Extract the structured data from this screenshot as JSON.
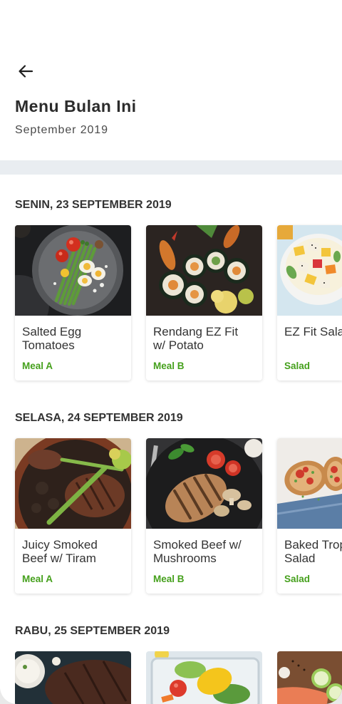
{
  "colors": {
    "accent": "#45a01c",
    "divider": "#e9edf1",
    "text": "#333333"
  },
  "icons": {
    "back": "arrow-left-icon"
  },
  "header": {
    "title": "Menu Bulan Ini",
    "subtitle": "September 2019"
  },
  "days": [
    {
      "label": "SENIN, 23 SEPTEMBER 2019",
      "meals": [
        {
          "name": "Salted Egg\nTomatoes",
          "tag": "Meal A"
        },
        {
          "name": "Rendang EZ Fit\nw/ Potato",
          "tag": "Meal B"
        },
        {
          "name": "EZ Fit Sala",
          "tag": "Salad"
        }
      ]
    },
    {
      "label": "SELASA, 24 SEPTEMBER 2019",
      "meals": [
        {
          "name": "Juicy Smoked\nBeef w/ Tiram",
          "tag": "Meal A"
        },
        {
          "name": "Smoked Beef w/\nMushrooms",
          "tag": "Meal B"
        },
        {
          "name": "Baked Trop\nSalad",
          "tag": "Salad"
        }
      ]
    },
    {
      "label": "RABU, 25 SEPTEMBER 2019"
    }
  ]
}
